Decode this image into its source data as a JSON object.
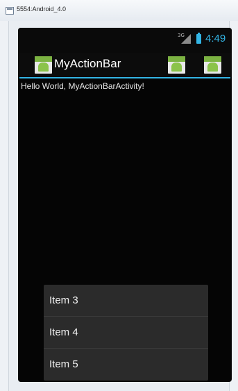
{
  "window": {
    "title": "5554:Android_4.0"
  },
  "status_bar": {
    "network": "3G",
    "time": "4:49"
  },
  "action_bar": {
    "title": "MyActionBar"
  },
  "content": {
    "text": "Hello World, MyActionBarActivity!"
  },
  "overflow_menu": {
    "items": [
      {
        "label": "Item 3"
      },
      {
        "label": "Item 4"
      },
      {
        "label": "Item 5"
      }
    ]
  },
  "colors": {
    "accent": "#33b5e5",
    "background": "#050505",
    "menu_background": "#2b2b2b"
  },
  "icons": [
    "window-app-icon",
    "signal-icon",
    "battery-icon",
    "app-icon",
    "action-icon"
  ]
}
